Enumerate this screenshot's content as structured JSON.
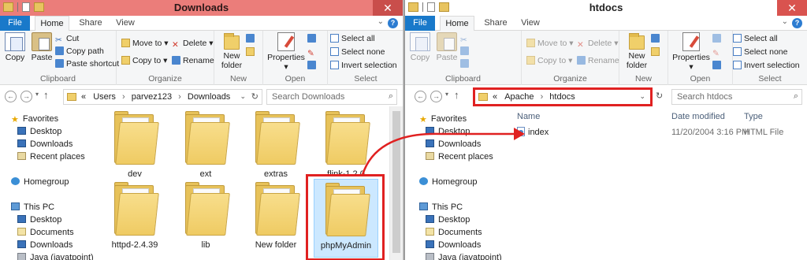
{
  "colors": {
    "highlight": "#e02121",
    "file_tab": "#1979ca",
    "left_titlebar": "#eb7d7a",
    "folder": "#f0cf6a"
  },
  "left": {
    "title": "Downloads",
    "tabs": {
      "file": "File",
      "home": "Home",
      "share": "Share",
      "view": "View"
    },
    "ribbon": {
      "copy": "Copy",
      "paste": "Paste",
      "cut": "Cut",
      "copy_path": "Copy path",
      "paste_shortcut": "Paste shortcut",
      "move_to": "Move to",
      "copy_to": "Copy to",
      "delete": "Delete",
      "rename": "Rename",
      "new_folder_line1": "New",
      "new_folder_line2": "folder",
      "properties": "Properties",
      "select_all": "Select all",
      "select_none": "Select none",
      "invert_selection": "Invert selection",
      "groups": {
        "clipboard": "Clipboard",
        "organize": "Organize",
        "new": "New",
        "open": "Open",
        "select": "Select"
      }
    },
    "address": {
      "prefix": "«",
      "segments": [
        "Users",
        "parvez123",
        "Downloads"
      ]
    },
    "search_placeholder": "Search Downloads",
    "nav": {
      "favorites": "Favorites",
      "desktop": "Desktop",
      "downloads": "Downloads",
      "recent": "Recent places",
      "homegroup": "Homegroup",
      "this_pc": "This PC",
      "pc_desktop": "Desktop",
      "documents": "Documents",
      "pc_downloads": "Downloads",
      "drive": "Java (javatpoint)"
    },
    "folders": [
      "dev",
      "ext",
      "extras",
      "flink-1.2.0",
      "httpd-2.4.39",
      "lib",
      "New folder",
      "phpMyAdmin"
    ]
  },
  "right": {
    "title": "htdocs",
    "tabs": {
      "file": "File",
      "home": "Home",
      "share": "Share",
      "view": "View"
    },
    "ribbon": {
      "copy": "Copy",
      "paste": "Paste",
      "move_to": "Move to",
      "copy_to": "Copy to",
      "delete": "Delete",
      "rename": "Rename",
      "new_folder_line1": "New",
      "new_folder_line2": "folder",
      "properties": "Properties",
      "select_all": "Select all",
      "select_none": "Select none",
      "invert_selection": "Invert selection",
      "groups": {
        "clipboard": "Clipboard",
        "organize": "Organize",
        "new": "New",
        "open": "Open",
        "select": "Select"
      }
    },
    "address": {
      "prefix": "«",
      "segments": [
        "Apache",
        "htdocs"
      ]
    },
    "search_placeholder": "Search htdocs",
    "nav": {
      "favorites": "Favorites",
      "desktop": "Desktop",
      "downloads": "Downloads",
      "recent": "Recent places",
      "homegroup": "Homegroup",
      "this_pc": "This PC",
      "pc_desktop": "Desktop",
      "documents": "Documents",
      "pc_downloads": "Downloads",
      "drive": "Java (javatpoint)"
    },
    "columns": {
      "name": "Name",
      "date": "Date modified",
      "type": "Type"
    },
    "files": [
      {
        "name": "index",
        "date": "11/20/2004 3:16 PM",
        "type": "HTML File"
      }
    ]
  }
}
